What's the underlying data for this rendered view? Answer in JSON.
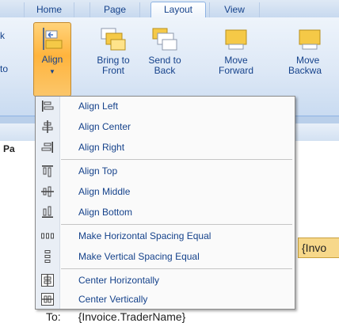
{
  "tabs": [
    "Home",
    "Page",
    "Layout",
    "View"
  ],
  "ribbon": {
    "left_fragments": [
      "to",
      "k"
    ],
    "buttons": [
      {
        "label": "Align"
      },
      {
        "label": "Bring to Front",
        "line1": "Bring to",
        "line2": "Front"
      },
      {
        "label": "Send to Back",
        "line1": "Send to",
        "line2": "Back"
      },
      {
        "label": "Move Forward",
        "line1": "Move",
        "line2": "Forward"
      },
      {
        "label": "Move Backward",
        "line1": "Move",
        "line2": "Backwa"
      }
    ]
  },
  "document": {
    "pane_label": "Pa",
    "field_text": "{Invo",
    "to_label": "To:",
    "to_value": "{Invoice.TraderName}"
  },
  "menu": {
    "items": [
      {
        "label": "Align Left",
        "icon": "align-left-icon"
      },
      {
        "label": "Align Center",
        "icon": "align-center-icon"
      },
      {
        "label": "Align Right",
        "icon": "align-right-icon"
      },
      {
        "label": "Align Top",
        "icon": "align-top-icon"
      },
      {
        "label": "Align Middle",
        "icon": "align-middle-icon"
      },
      {
        "label": "Align Bottom",
        "icon": "align-bottom-icon"
      },
      {
        "label": "Make Horizontal Spacing Equal",
        "icon": "horizontal-spacing-icon"
      },
      {
        "label": "Make Vertical Spacing Equal",
        "icon": "vertical-spacing-icon"
      },
      {
        "label": "Center Horizontally",
        "icon": "center-horizontally-icon"
      },
      {
        "label": "Center Vertically",
        "icon": "center-vertically-icon"
      }
    ]
  }
}
